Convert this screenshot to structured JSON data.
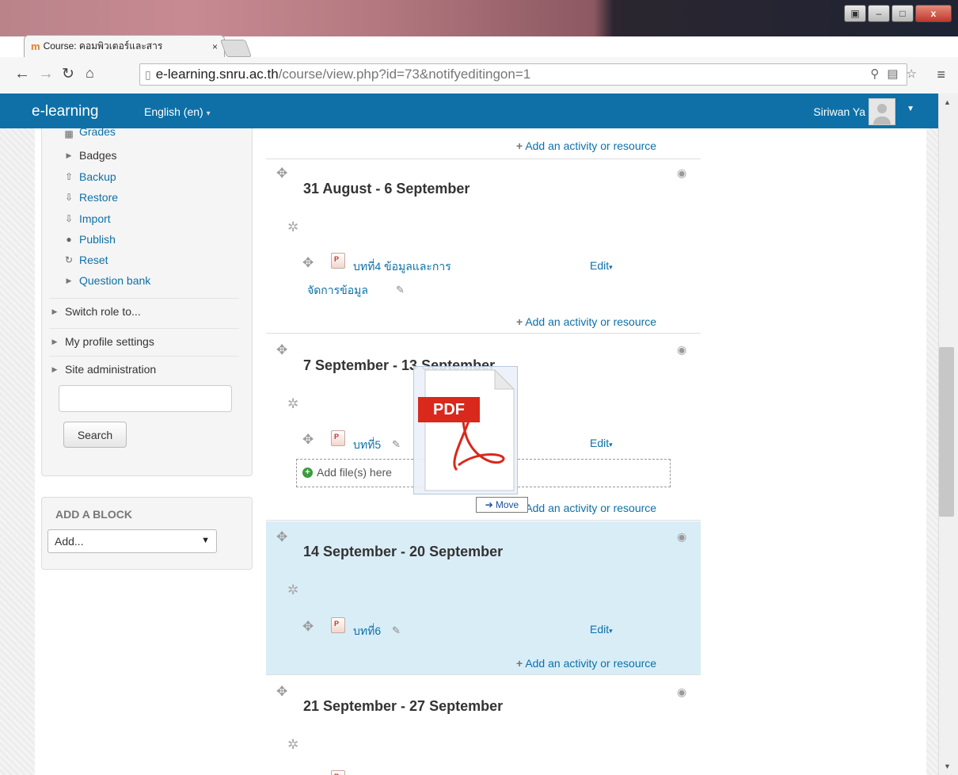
{
  "browser": {
    "tab_title": "Course: คอมพิวเตอร์และสาร",
    "tab_close": "×",
    "url_host": "e-learning.snru.ac.th",
    "url_path": "/course/view.php?id=73&notifyeditingon=1",
    "window_controls": {
      "restore": "▣",
      "minimize": "–",
      "maximize": "□",
      "close": "x"
    }
  },
  "navbar": {
    "brand": "e-learning",
    "language": "English (en)",
    "user": "Siriwan Ya"
  },
  "sidebar": {
    "admin_items": [
      {
        "label": "Grades",
        "icon": "grades-icon"
      },
      {
        "label": "Badges",
        "icon": "triangle-right-icon"
      },
      {
        "label": "Backup",
        "icon": "upload-icon"
      },
      {
        "label": "Restore",
        "icon": "download-icon"
      },
      {
        "label": "Import",
        "icon": "import-icon"
      },
      {
        "label": "Publish",
        "icon": "globe-icon"
      },
      {
        "label": "Reset",
        "icon": "reset-icon"
      },
      {
        "label": "Question bank",
        "icon": "triangle-right-icon"
      }
    ],
    "sections": [
      {
        "label": "Switch role to..."
      },
      {
        "label": "My profile settings"
      },
      {
        "label": "Site administration"
      }
    ],
    "search_button": "Search",
    "add_block_title": "ADD A BLOCK",
    "add_block_select": "Add..."
  },
  "course": {
    "add_activity": "Add an activity or resource",
    "edit_label": "Edit",
    "sections": [
      {
        "title": "31 August - 6 September",
        "activity": "บทที่4 ข้อมูลและการ",
        "activity_line2": "จัดการข้อมูล"
      },
      {
        "title": "7 September - 13 September",
        "activity": "บทที่5"
      },
      {
        "title": "14 September - 20 September",
        "activity": "บทที่6"
      },
      {
        "title": "21 September - 27 September"
      }
    ],
    "dropzone_text": "Add file(s) here",
    "drag_badge": "PDF",
    "move_tooltip": "Move"
  },
  "colors": {
    "navbar": "#0e70a7",
    "link": "#0e70a7",
    "highlight_section": "#d9edf7",
    "pdf_red": "#d9281c"
  }
}
